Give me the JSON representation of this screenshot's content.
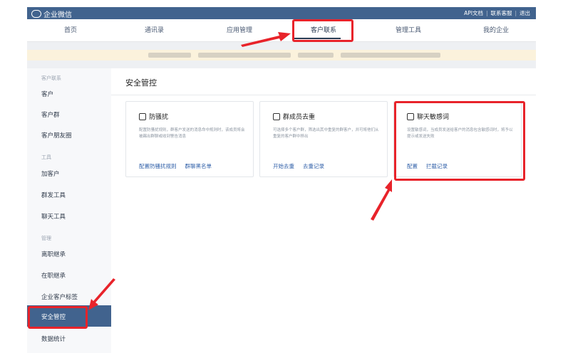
{
  "topbar": {
    "logo": "企业微信",
    "links": [
      "API文档",
      "联系客服",
      "退出"
    ],
    "separator": "|"
  },
  "nav": {
    "items": [
      "首页",
      "通讯录",
      "应用管理",
      "客户联系",
      "管理工具",
      "我的企业"
    ],
    "active": "客户联系"
  },
  "sidebar": {
    "groups": [
      {
        "label": "客户联系",
        "items": [
          "客户",
          "客户群",
          "客户朋友圈"
        ]
      },
      {
        "label": "工具",
        "items": [
          "加客户",
          "群发工具",
          "聊天工具"
        ]
      },
      {
        "label": "管理",
        "items": [
          "离职继承",
          "在职继承",
          "企业客户标签",
          "安全管控",
          "数据统计"
        ]
      }
    ],
    "active": "安全管控"
  },
  "main": {
    "title": "安全管控",
    "cards": [
      {
        "icon": "anti-harass-icon",
        "title": "防骚扰",
        "desc": "配置防骚扰规则，群客户发送的消息命中规则时，该成员将会被踢出群聊或收到警告消息",
        "actions": [
          "配置防骚扰规则",
          "群聊黑名单"
        ]
      },
      {
        "icon": "dedupe-icon",
        "title": "群成员去重",
        "desc": "可选择多个客户群，筛选出其中重复的群客户，并可将他们从重复的客户群中移出",
        "actions": [
          "开始去重",
          "去重记录"
        ]
      },
      {
        "icon": "sensitive-words-icon",
        "title": "聊天敏感词",
        "desc": "设置敏感词，当成员发送给客户的消息包含敏感词时，将予以提示或发送失败",
        "actions": [
          "配置",
          "拦截记录"
        ]
      }
    ]
  },
  "colors": {
    "topbar": "#41638e",
    "sidebar_active": "#41638e",
    "link": "#2f5fa8",
    "highlight": "#e8232a",
    "notice": "#fbf2dc"
  }
}
